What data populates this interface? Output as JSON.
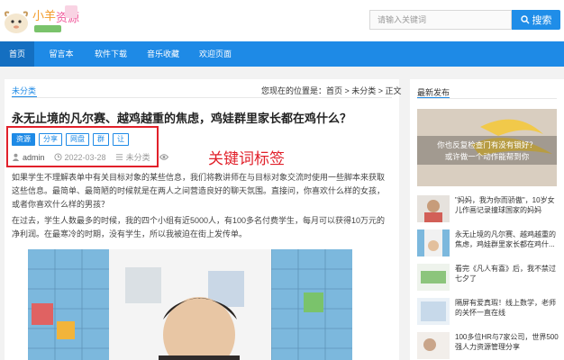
{
  "header": {
    "logo_text": "小羊资源",
    "search_placeholder": "请输入关键词",
    "search_button": "搜索",
    "search_icon": "search-icon"
  },
  "nav": {
    "items": [
      {
        "label": "首页",
        "active": true
      },
      {
        "label": "留言本",
        "active": false
      },
      {
        "label": "软件下载",
        "active": false
      },
      {
        "label": "音乐收藏",
        "active": false
      },
      {
        "label": "欢迎页面",
        "active": false
      }
    ]
  },
  "article": {
    "category": "未分类",
    "breadcrumb": "您现在的位置是：首页 > 未分类 > 正文",
    "title": "永无止境的凡尔赛、越鸡越重的焦虑，鸡娃群里家长都在鸡什么？",
    "tags": [
      "资源",
      "分享",
      "网盘",
      "群",
      "让"
    ],
    "author": "admin",
    "date": "2022-03-28",
    "meta_category": "未分类",
    "paragraph1": "如果学生不理解表单中有关目标对象的某些信息，我们将教讲师在与目标对象交流时使用一些脚本来获取这些信息。最简单、最简陋的时候就是在两人之间营造良好的聊天氛围。直接问，你喜欢什么样的女孩，或者你喜欢什么样的男孩？",
    "paragraph2": "在过去，学生人数最多的时候，我的四个小组有近5000人，有100多名付费学生，每月可以获得10万元的净利润。在最寒冷的时期，没有学生，所以我被迫在街上发传单。",
    "annotation": "关键词标签"
  },
  "sidebar": {
    "heading": "最新发布",
    "promo_line1": "你也反复检查门有没有锁好？",
    "promo_line2": "或许做一个动作能帮到你",
    "items": [
      {
        "text": "\"妈妈，我为你而骄傲\"，10岁女儿作画记录撞球国家的妈妈"
      },
      {
        "text": "永无止境的凡尔赛、越鸡越重的焦虑，鸡娃群里家长都在鸡什..."
      },
      {
        "text": "看完《凡人有喜》后，我不禁过七夕了"
      },
      {
        "text": "隔屏有爱真瑕！线上数学，老师的关怀一直在线"
      },
      {
        "text": "100多位HR与7家公司，世界500强人力资源管理分享"
      }
    ]
  },
  "colors": {
    "brand_blue": "#1e8ae6",
    "annotation_red": "#e1202a"
  }
}
